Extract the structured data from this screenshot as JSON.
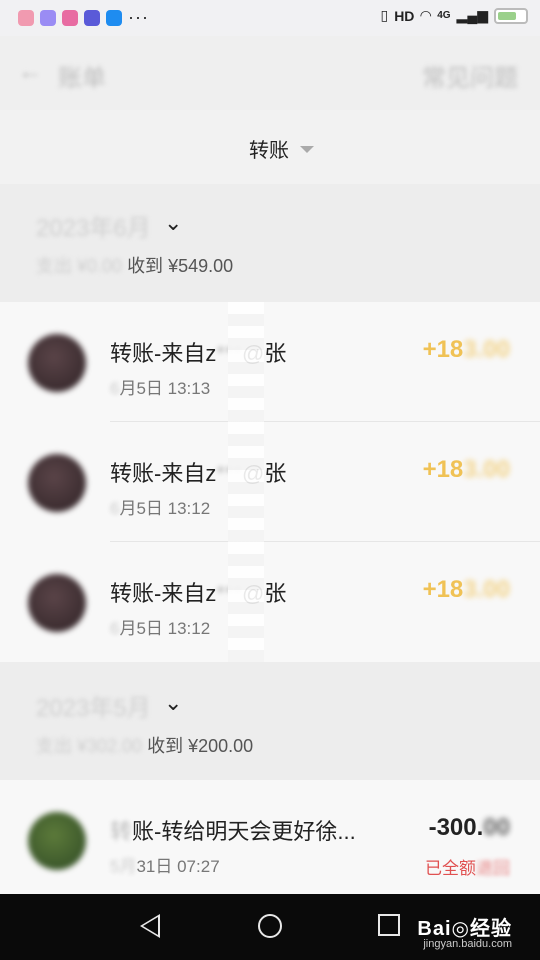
{
  "status_bar": {
    "time": "",
    "app_icons": [
      "#f19ab0",
      "#9a8cf4",
      "#e86ca2",
      "#5a5ad8",
      "#1e8cf0"
    ],
    "more": "···",
    "signal_labels": [
      "HD",
      "4G"
    ],
    "icons": [
      "vibrate-icon",
      "wifi-icon",
      "signal-icon",
      "battery-icon"
    ]
  },
  "nav": {
    "back": "←",
    "title": "账单",
    "right": "常见问题"
  },
  "filter": {
    "label": "转账"
  },
  "months": [
    {
      "title": "2023年6月",
      "summary_prefix": "支出 ¥0.00",
      "summary_suffix": "收到 ¥549.00"
    },
    {
      "title": "2023年5月",
      "summary_prefix": "支出 ¥302.00",
      "summary_suffix": "收到 ¥200.00"
    }
  ],
  "transactions": [
    {
      "title_visible": "转账-来自z",
      "title_hidden": "***",
      "title_tail": "@张",
      "time_hidden": "6",
      "time_visible": "月5日 13:13",
      "amount_visible": "+18",
      "amount_hidden": "3.00"
    },
    {
      "title_visible": "转账-来自z",
      "title_hidden": "***",
      "title_tail": "@张",
      "time_hidden": "6",
      "time_visible": "月5日 13:12",
      "amount_visible": "+18",
      "amount_hidden": "3.00"
    },
    {
      "title_visible": "转账-来自z",
      "title_hidden": "***",
      "title_tail": "@张",
      "time_hidden": "6",
      "time_visible": "月5日 13:12",
      "amount_visible": "+18",
      "amount_hidden": "3.00"
    },
    {
      "title_visible": "账-转给明天会更好徐...",
      "title_hidden": "转",
      "time_hidden": "5月",
      "time_visible": "31日 07:27",
      "amount_visible": "-300.",
      "amount_hidden": "00",
      "status_visible": "已全额",
      "status_hidden": "退回"
    }
  ],
  "watermark": {
    "brand": "Bai◎经验",
    "url": "jingyan.baidu.com"
  },
  "colors": {
    "income": "#f0c255",
    "refund": "#e05050",
    "background": "#ededed"
  }
}
